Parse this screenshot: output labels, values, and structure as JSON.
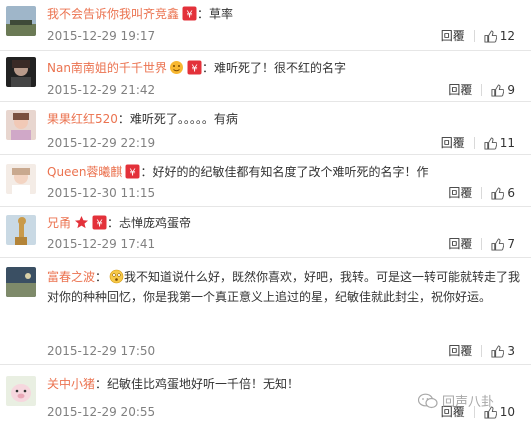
{
  "comments": [
    {
      "name": "我不会告诉你我叫齐竞鑫",
      "sep": "：",
      "text": "草率",
      "time": "2015-12-29 19:17",
      "reply": "回覆",
      "likes": "12"
    },
    {
      "name": "Nan南南姐的千千世界",
      "sep": "：",
      "text": "难听死了！很不红的名字",
      "time": "2015-12-29 21:42",
      "reply": "回覆",
      "likes": "9"
    },
    {
      "name": "果果红红520",
      "sep": "：",
      "text": "难听死了。。。。。有病",
      "time": "2015-12-29 22:19",
      "reply": "回覆",
      "likes": "11"
    },
    {
      "name": "Queen蓉曦麒",
      "sep": "：",
      "text": "好好的的纪敏佳都有知名度了改个难听死的名字！作",
      "time": "2015-12-30 11:15",
      "reply": "回覆",
      "likes": "6"
    },
    {
      "name": "兄甬",
      "sep": "：",
      "text": "忐惮庞鸡蛋帝",
      "time": "2015-12-29 17:41",
      "reply": "回覆",
      "likes": "7"
    },
    {
      "name": "富春之波",
      "sep": "：",
      "text": "我不知道说什么好，既然你喜欢，好吧，我转。可是这一转可能就转走了我对你的种种回忆，你是我第一个真正意义上追过的星，纪敏佳就此封尘，祝你好运。",
      "time": "2015-12-29 17:50",
      "reply": "回覆",
      "likes": "3"
    },
    {
      "name": "关中小猪",
      "sep": "：",
      "text": "纪敏佳比鸡蛋地好听一千倍！无知！",
      "time": "2015-12-29 20:55",
      "reply": "回覆",
      "likes": "10"
    }
  ],
  "watermark": "回声八卦",
  "icons": {
    "badge": "member-badge-icon",
    "like": "thumbs-up-icon",
    "star": "star-icon",
    "emoji": "confused-emoji-icon",
    "wechat": "wechat-icon"
  },
  "colors": {
    "name": "#eb7350",
    "time": "#808080",
    "badge": "#e3313a",
    "divider": "#e6e6e6"
  }
}
